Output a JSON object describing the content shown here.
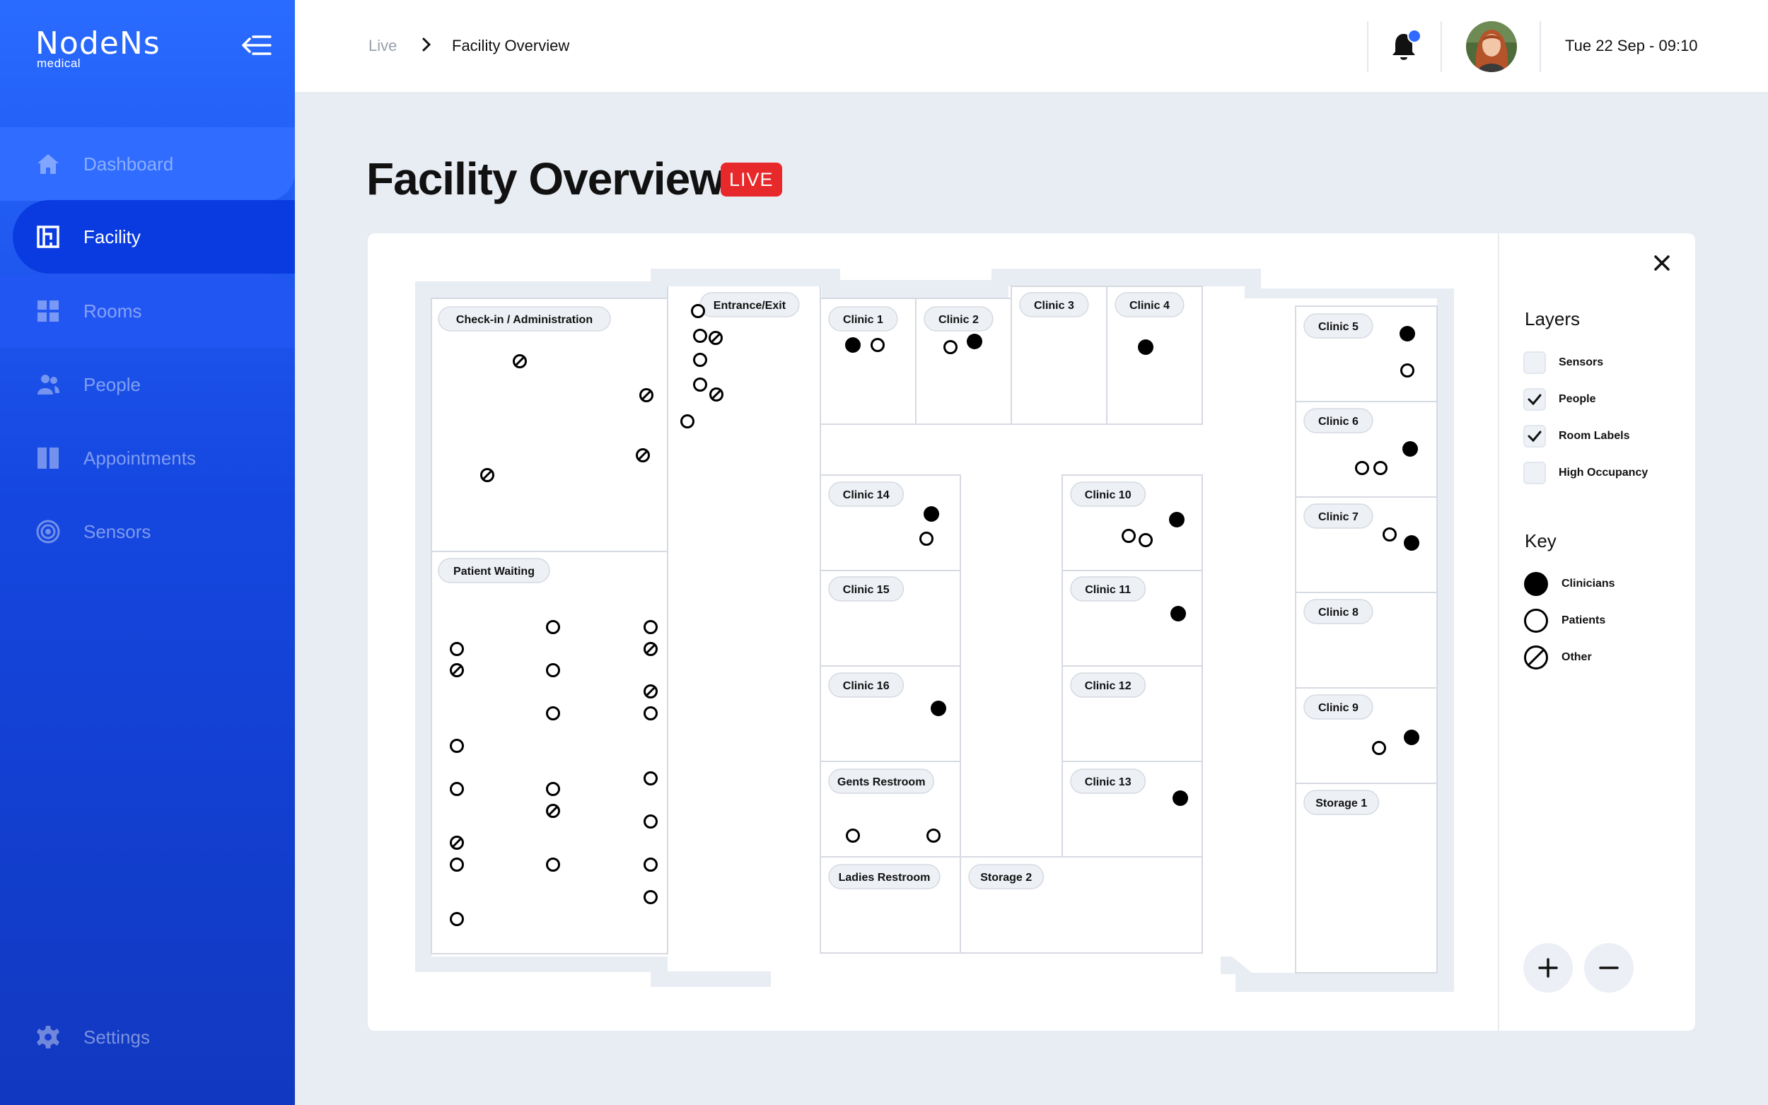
{
  "app": {
    "brand": "NodeNs",
    "brand_sub": "medical"
  },
  "sidebar": {
    "items": [
      {
        "label": "Dashboard",
        "icon": "home-icon"
      },
      {
        "label": "Facility",
        "icon": "facility-icon",
        "active": true
      },
      {
        "label": "Rooms",
        "icon": "grid-icon"
      },
      {
        "label": "People",
        "icon": "people-icon"
      },
      {
        "label": "Appointments",
        "icon": "columns-icon"
      },
      {
        "label": "Sensors",
        "icon": "target-icon"
      }
    ],
    "settings": {
      "label": "Settings",
      "icon": "gear-icon"
    }
  },
  "header": {
    "breadcrumb": {
      "parent": "Live",
      "current": "Facility Overview"
    },
    "datetime": "Tue 22 Sep - 09:10",
    "notification_dot_color": "#2F6BFF"
  },
  "page": {
    "title": "Facility Overview",
    "badge": "LIVE"
  },
  "map": {
    "rooms": [
      "Check-in / Administration",
      "Entrance/Exit",
      "Clinic 1",
      "Clinic 2",
      "Clinic 3",
      "Clinic 4",
      "Clinic 5",
      "Clinic 6",
      "Clinic 7",
      "Clinic 8",
      "Clinic 9",
      "Storage 1",
      "Clinic 14",
      "Clinic 15",
      "Clinic 16",
      "Gents Restroom",
      "Ladies Restroom",
      "Storage 2",
      "Clinic 10",
      "Clinic 11",
      "Clinic 12",
      "Clinic 13",
      "Patient Waiting"
    ]
  },
  "panel": {
    "layers_title": "Layers",
    "layers": [
      {
        "label": "Sensors",
        "checked": false
      },
      {
        "label": "People",
        "checked": true
      },
      {
        "label": "Room Labels",
        "checked": true
      },
      {
        "label": "High Occupancy",
        "checked": false
      }
    ],
    "key_title": "Key",
    "key": [
      {
        "label": "Clinicians",
        "symbol": "filled-circle-icon"
      },
      {
        "label": "Patients",
        "symbol": "hollow-circle-icon"
      },
      {
        "label": "Other",
        "symbol": "slashed-circle-icon"
      }
    ]
  }
}
